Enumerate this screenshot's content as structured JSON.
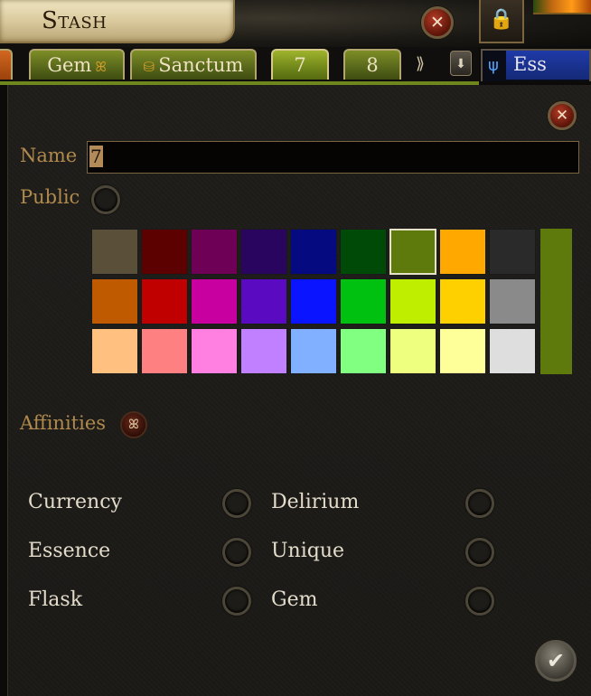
{
  "window": {
    "title": "Stash",
    "lock_icon": "lock-icon",
    "close_icon": "close-icon"
  },
  "tabs": [
    {
      "label": "",
      "color": "#c55a17"
    },
    {
      "label": "Gem",
      "icon": "affinity-icon",
      "color": "#6e801f"
    },
    {
      "label": "Sanctum",
      "icon": "coin-stack-icon",
      "color": "#6e801f"
    },
    {
      "label": "7",
      "color": "#80971f",
      "active": true
    },
    {
      "label": "8",
      "color": "#6e801f"
    },
    {
      "label": "Ess",
      "icon": "essence-icon",
      "color": "#1f3aa8"
    }
  ],
  "tabbar_controls": {
    "next_icon": "arrow-right-icon",
    "dropdown_icon": "chevron-down-icon"
  },
  "form": {
    "name_label": "Name",
    "name_value": "7",
    "public_label": "Public",
    "affinities_label": "Affinities"
  },
  "colors": {
    "selected": "#5e7a0d",
    "swatches": [
      [
        "#5a4f38",
        "#5c0000",
        "#6e0055",
        "#2a0560",
        "#050a80",
        "#004a08",
        "#5e7a0d",
        "#ffa800",
        "#2a2a2a"
      ],
      [
        "#c05a00",
        "#c00000",
        "#c800a0",
        "#5a0ac0",
        "#0a14ff",
        "#00c010",
        "#bfee00",
        "#ffd000",
        "#8a8a8a"
      ],
      [
        "#ffc080",
        "#ff8080",
        "#ff80e0",
        "#c080ff",
        "#80b0ff",
        "#80ff80",
        "#eeff80",
        "#ffff9a",
        "#dedede"
      ]
    ],
    "selected_index": [
      0,
      6
    ]
  },
  "affinities": [
    {
      "label": "Currency",
      "checked": false
    },
    {
      "label": "Delirium",
      "checked": false
    },
    {
      "label": "Essence",
      "checked": false
    },
    {
      "label": "Unique",
      "checked": false
    },
    {
      "label": "Flask",
      "checked": false
    },
    {
      "label": "Gem",
      "checked": false
    }
  ],
  "confirm_icon": "checkmark-icon"
}
